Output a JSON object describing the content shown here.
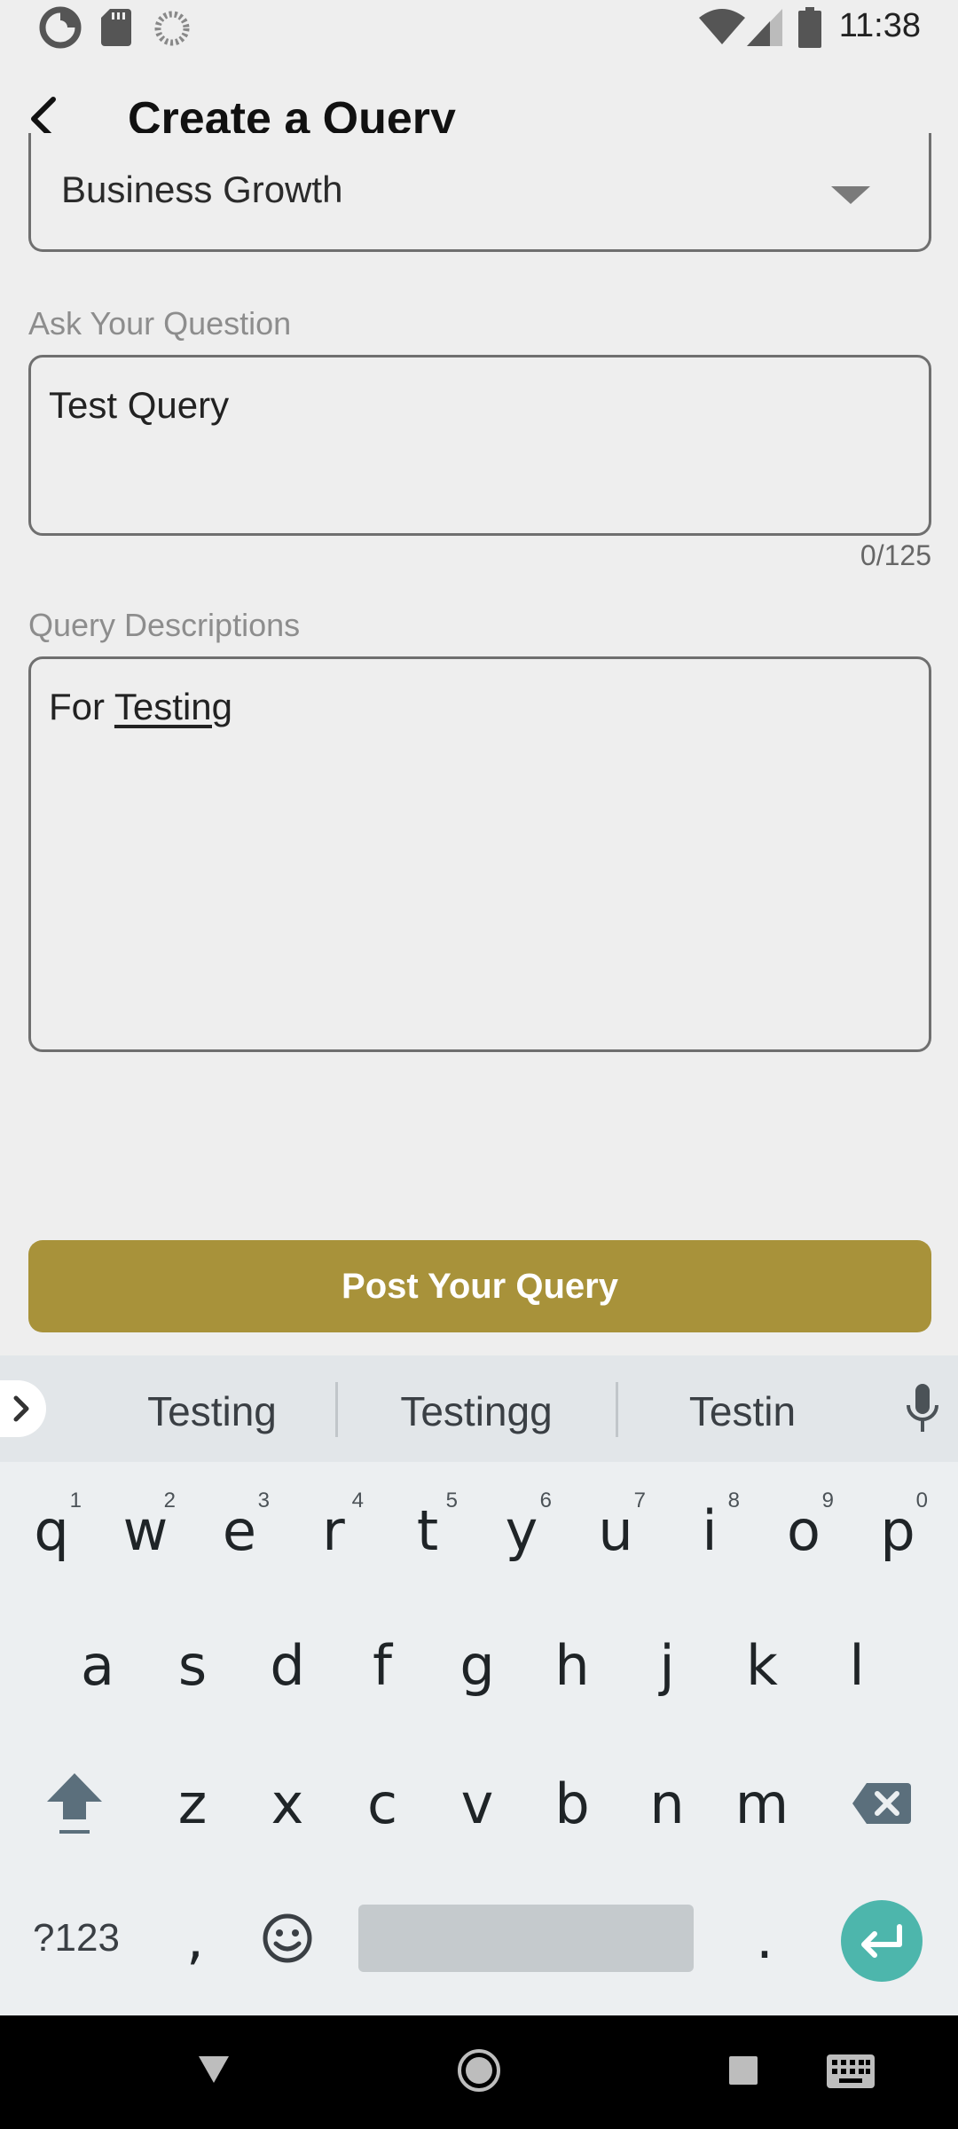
{
  "status_bar": {
    "time": "11:38"
  },
  "header": {
    "title": "Create a Query"
  },
  "form": {
    "category_value": "Business Growth",
    "question_label": "Ask Your Question",
    "question_value": "Test Query",
    "question_counter": "0/125",
    "description_label": "Query Descriptions",
    "description_value_prefix": "For ",
    "description_value_word": "Testing",
    "submit_label": "Post Your Query"
  },
  "keyboard": {
    "suggestions": [
      "Testing",
      "Testingg",
      "Testin"
    ],
    "row1": [
      {
        "key": "q",
        "num": "1"
      },
      {
        "key": "w",
        "num": "2"
      },
      {
        "key": "e",
        "num": "3"
      },
      {
        "key": "r",
        "num": "4"
      },
      {
        "key": "t",
        "num": "5"
      },
      {
        "key": "y",
        "num": "6"
      },
      {
        "key": "u",
        "num": "7"
      },
      {
        "key": "i",
        "num": "8"
      },
      {
        "key": "o",
        "num": "9"
      },
      {
        "key": "p",
        "num": "0"
      }
    ],
    "row2": [
      "a",
      "s",
      "d",
      "f",
      "g",
      "h",
      "j",
      "k",
      "l"
    ],
    "row3": [
      "z",
      "x",
      "c",
      "v",
      "b",
      "n",
      "m"
    ],
    "symbols_label": "?123",
    "comma": ",",
    "period": "."
  },
  "colors": {
    "accent": "#a8923a",
    "enter_key": "#4db6ac"
  }
}
